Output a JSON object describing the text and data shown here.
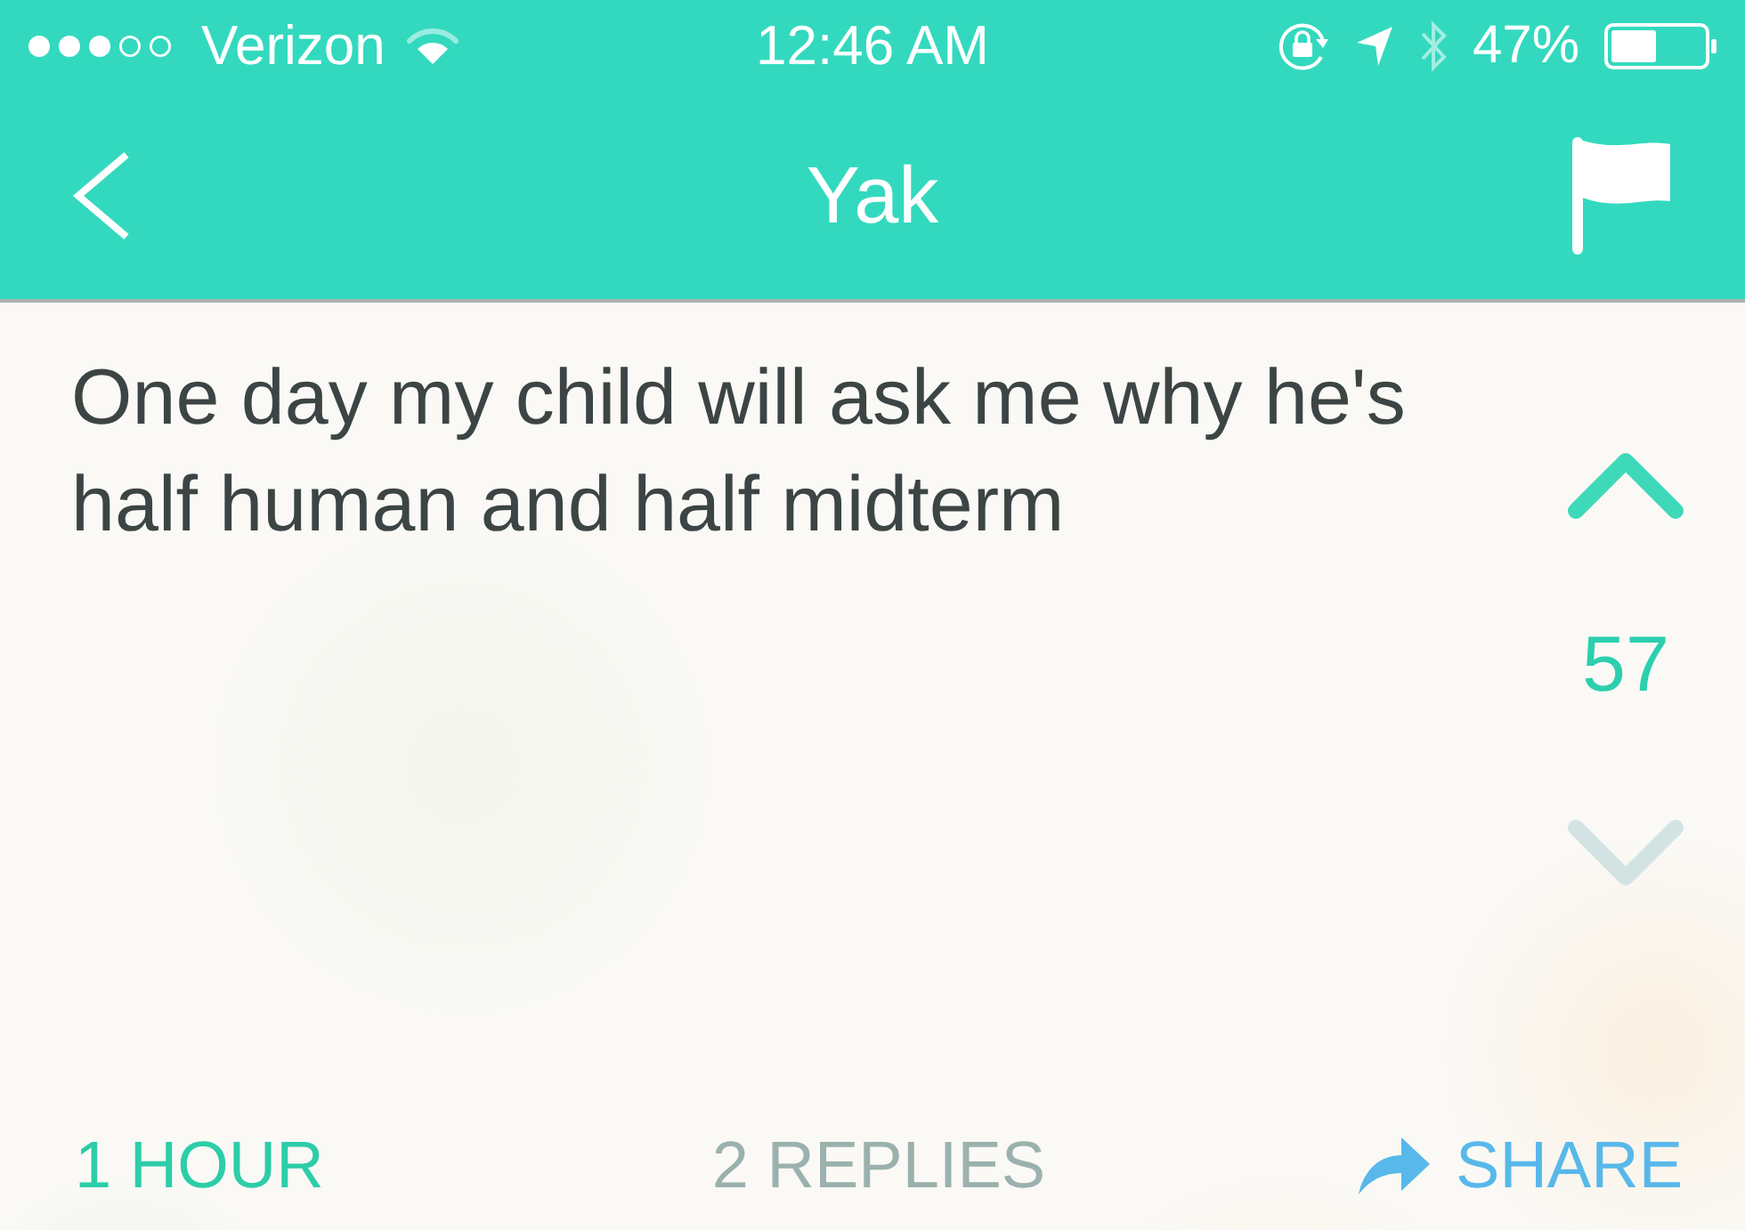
{
  "status_bar": {
    "carrier": "Verizon",
    "time": "12:46 AM",
    "battery": "47%"
  },
  "nav_bar": {
    "title": "Yak"
  },
  "post": {
    "text": "One day my child will ask me why he's half human and half midterm",
    "upvote": {
      "selected": true
    },
    "votes": "57",
    "downvote": {
      "selected": false
    }
  },
  "footer": {
    "age": "1 HOUR",
    "replies": "2 REPLIES",
    "share": "SHARE"
  }
}
